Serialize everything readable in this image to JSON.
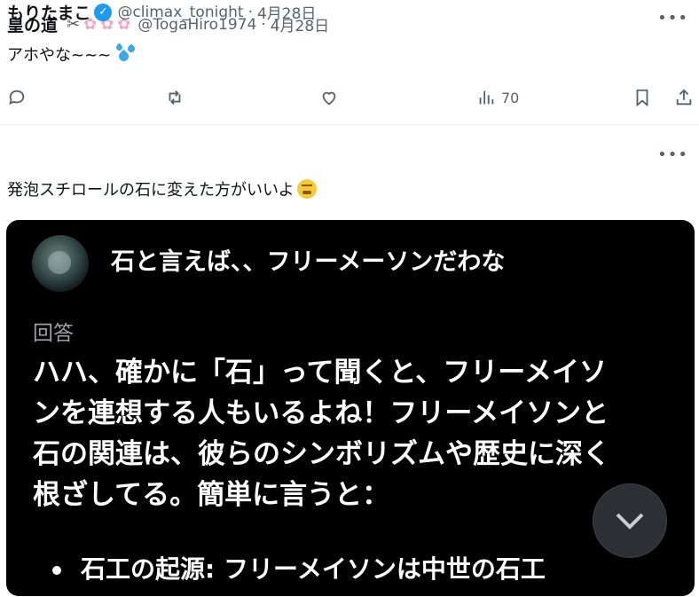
{
  "post1": {
    "name": "皇の道",
    "handle": "@TogaHiro1974",
    "separator": "·",
    "date": "4月28日",
    "text": "アホやな~~~",
    "views": "70",
    "emoji_icons": [
      "scissors-icon",
      "cherry-blossom-icon",
      "cherry-blossom-icon",
      "cherry-blossom-icon"
    ]
  },
  "post2": {
    "name": "もりたまこ",
    "handle": "@climax_tonight",
    "separator": "·",
    "date": "4月28日",
    "text": "発泡スチロールの石に変えた方がいいよ",
    "card": {
      "title": "石と言えば、、フリーメーソンだわな",
      "label": "回答",
      "lines": [
        "ハハ、確かに「石」って聞くと、フリーメイソ",
        "ンを連想する人もいるよね！フリーメイソンと",
        "石の関連は、彼らのシンボリズムや歴史に深く",
        "根ざしてる。簡単に言うと："
      ],
      "bullet": "石工の起源: フリーメイソンは中世の石工"
    }
  },
  "colors": {
    "accent": "#1d9bf0",
    "muted": "#536471",
    "card_bg": "#000000"
  }
}
